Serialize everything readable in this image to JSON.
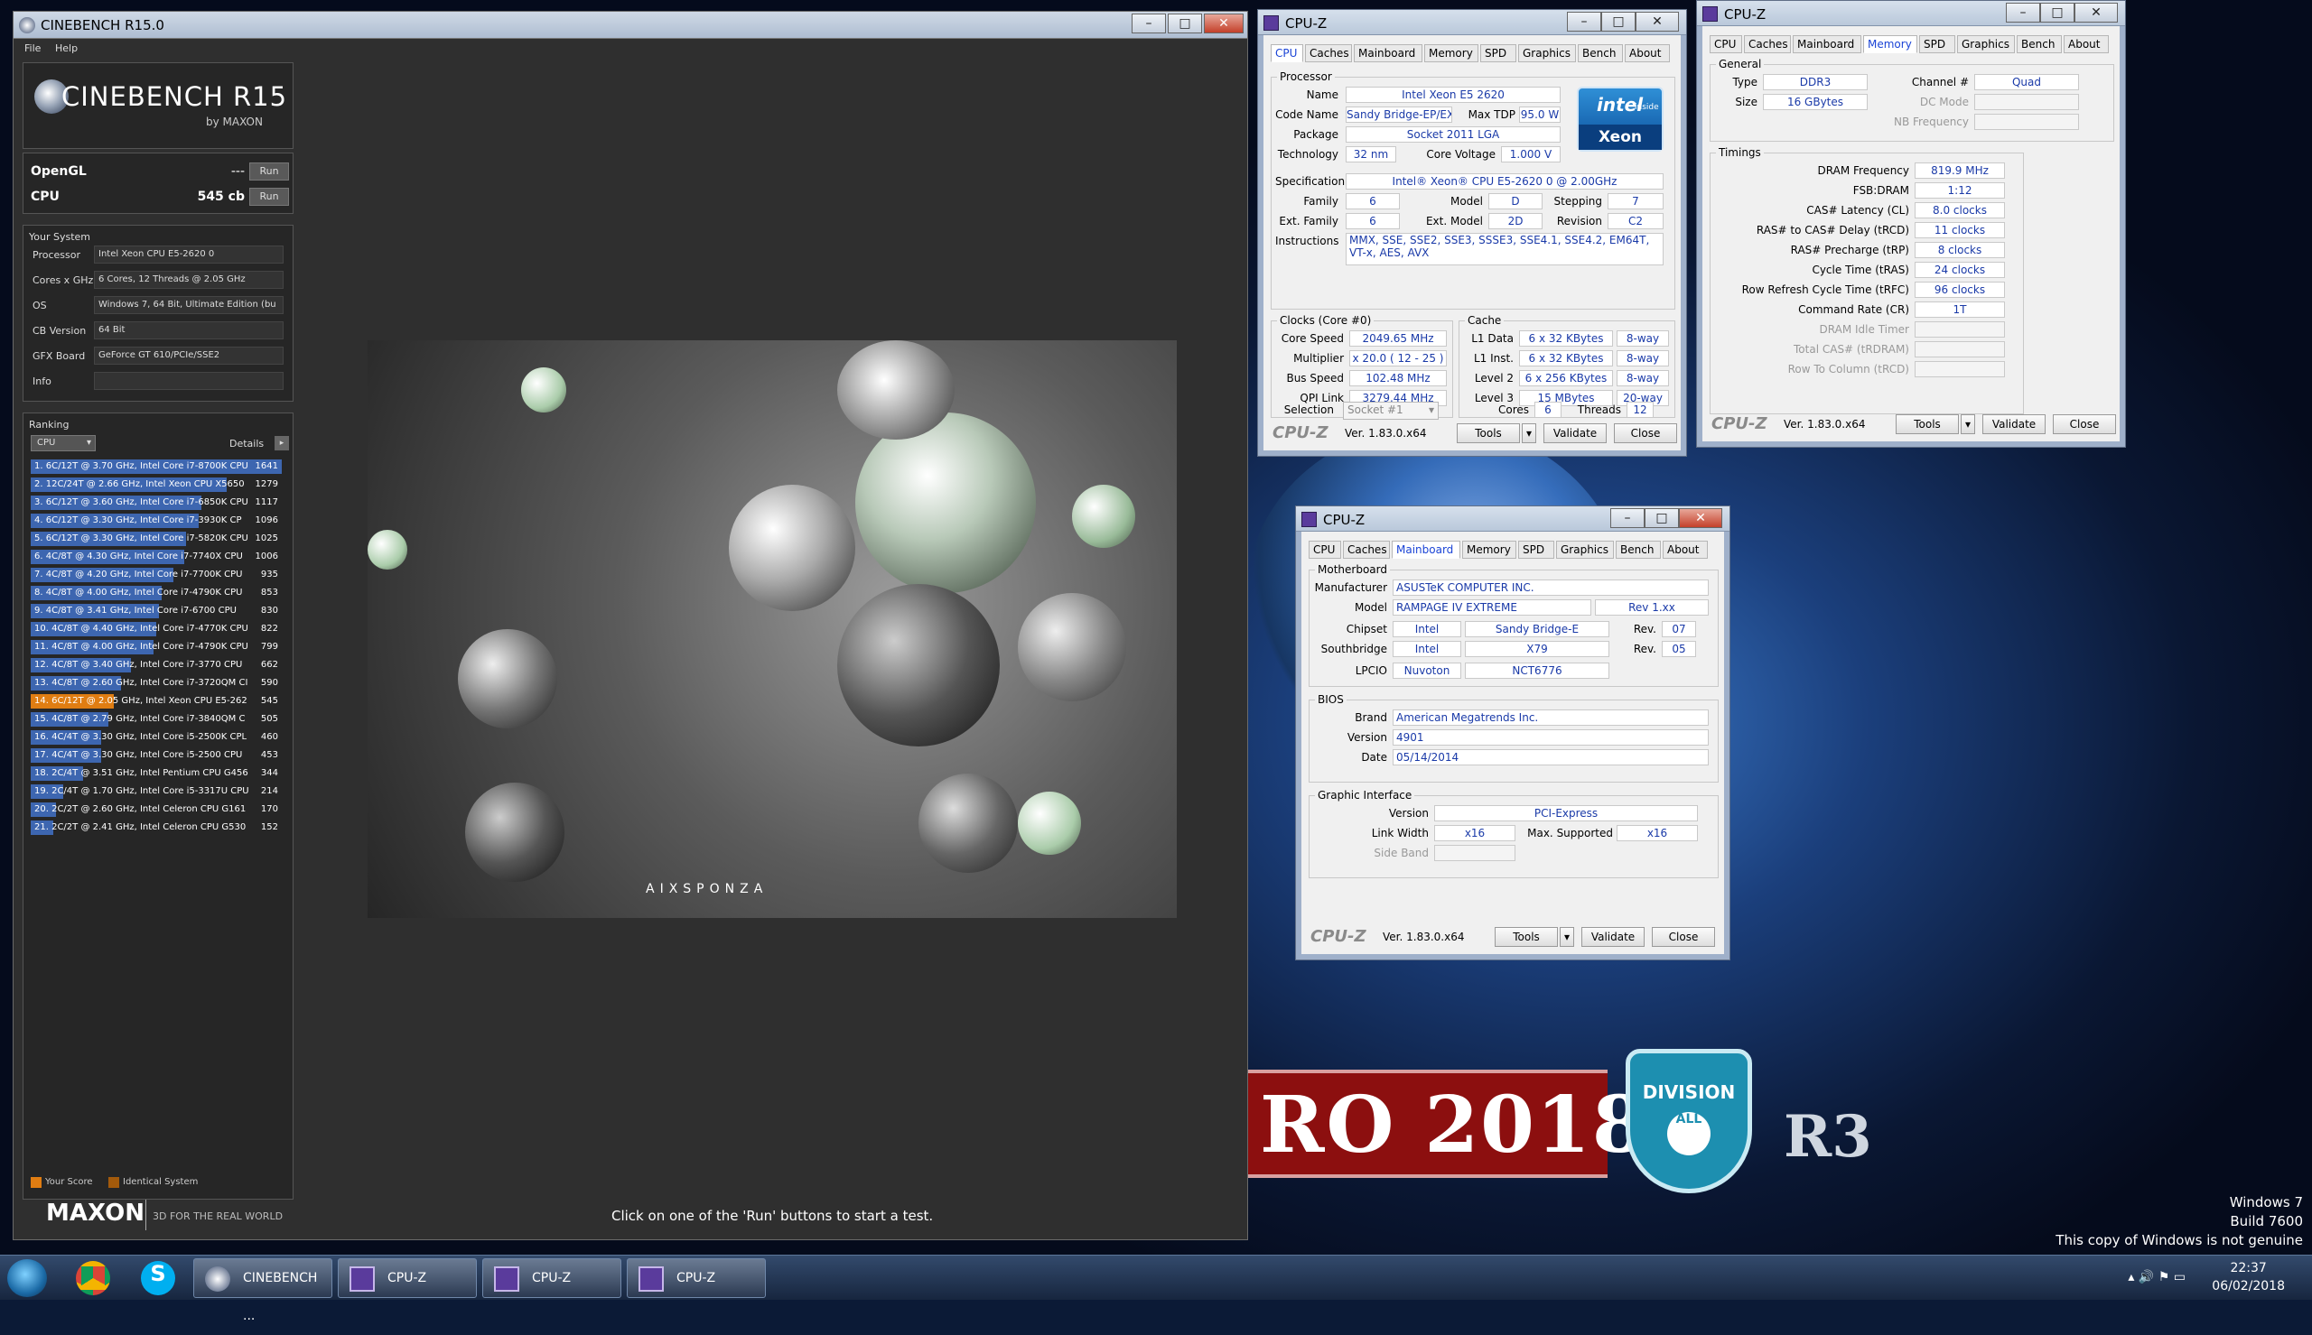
{
  "watermark": {
    "l1": "Windows 7",
    "l2": "Build 7600",
    "l3": "This copy of Windows is not genuine"
  },
  "banner": {
    "text": "RO 2018",
    "shield_top": "DIVISION",
    "shield_mid": "ALL",
    "right": "R3"
  },
  "cinebench": {
    "title": "CINEBENCH R15.0",
    "menu": {
      "file": "File",
      "help": "Help"
    },
    "logo": {
      "name": "CINEBENCH R15",
      "by": "by MAXON"
    },
    "opengl": {
      "label": "OpenGL",
      "value": "---",
      "run": "Run"
    },
    "cpu": {
      "label": "CPU",
      "value": "545 cb",
      "run": "Run"
    },
    "system": {
      "title": "Your System",
      "rows": [
        {
          "k": "Processor",
          "v": "Intel Xeon CPU E5-2620 0"
        },
        {
          "k": "Cores x GHz",
          "v": "6 Cores, 12 Threads @ 2.05 GHz"
        },
        {
          "k": "OS",
          "v": "Windows 7, 64 Bit, Ultimate Edition (bu"
        },
        {
          "k": "CB Version",
          "v": "64 Bit"
        },
        {
          "k": "GFX Board",
          "v": "GeForce GT 610/PCIe/SSE2"
        },
        {
          "k": "Info",
          "v": ""
        }
      ]
    },
    "ranking": {
      "title": "Ranking",
      "select": "CPU",
      "details": "Details",
      "items": [
        {
          "t": "1. 6C/12T @ 3.70 GHz, Intel Core i7-8700K CPU",
          "s": "1641",
          "f": 1.0
        },
        {
          "t": "2. 12C/24T @ 2.66 GHz, Intel Xeon CPU X5650",
          "s": "1279",
          "f": 0.78
        },
        {
          "t": "3. 6C/12T @ 3.60 GHz, Intel Core i7-6850K CPU",
          "s": "1117",
          "f": 0.68
        },
        {
          "t": "4. 6C/12T @ 3.30 GHz, Intel Core i7-3930K CP",
          "s": "1096",
          "f": 0.67
        },
        {
          "t": "5. 6C/12T @ 3.30 GHz, Intel Core i7-5820K CPU",
          "s": "1025",
          "f": 0.62
        },
        {
          "t": "6. 4C/8T @ 4.30 GHz, Intel Core i7-7740X CPU",
          "s": "1006",
          "f": 0.61
        },
        {
          "t": "7. 4C/8T @ 4.20 GHz, Intel Core i7-7700K CPU",
          "s": "935",
          "f": 0.57
        },
        {
          "t": "8. 4C/8T @ 4.00 GHz, Intel Core i7-4790K CPU",
          "s": "853",
          "f": 0.52
        },
        {
          "t": "9. 4C/8T @ 3.41 GHz, Intel Core i7-6700 CPU",
          "s": "830",
          "f": 0.51
        },
        {
          "t": "10. 4C/8T @ 4.40 GHz, Intel Core i7-4770K CPU",
          "s": "822",
          "f": 0.5
        },
        {
          "t": "11. 4C/8T @ 4.00 GHz, Intel Core i7-4790K CPU",
          "s": "799",
          "f": 0.49
        },
        {
          "t": "12. 4C/8T @ 3.40 GHz, Intel Core i7-3770 CPU",
          "s": "662",
          "f": 0.4
        },
        {
          "t": "13. 4C/8T @ 2.60 GHz, Intel Core i7-3720QM CI",
          "s": "590",
          "f": 0.36
        },
        {
          "t": "14. 6C/12T @ 2.05 GHz, Intel Xeon CPU E5-262",
          "s": "545",
          "f": 0.33,
          "mine": true
        },
        {
          "t": "15. 4C/8T @ 2.79 GHz, Intel Core i7-3840QM C",
          "s": "505",
          "f": 0.31
        },
        {
          "t": "16. 4C/4T @ 3.30 GHz, Intel Core i5-2500K CPL",
          "s": "460",
          "f": 0.28
        },
        {
          "t": "17. 4C/4T @ 3.30 GHz, Intel Core i5-2500 CPU",
          "s": "453",
          "f": 0.28
        },
        {
          "t": "18. 2C/4T @ 3.51 GHz, Intel Pentium CPU G456",
          "s": "344",
          "f": 0.21
        },
        {
          "t": "19. 2C/4T @ 1.70 GHz, Intel Core i5-3317U CPU",
          "s": "214",
          "f": 0.13
        },
        {
          "t": "20. 2C/2T @ 2.60 GHz, Intel Celeron CPU G161",
          "s": "170",
          "f": 0.1
        },
        {
          "t": "21. 2C/2T @ 2.41 GHz, Intel Celeron CPU G530",
          "s": "152",
          "f": 0.09
        }
      ],
      "legend_yours": "Your Score",
      "legend_identical": "Identical System"
    },
    "render_brand": "AIXSPONZA",
    "maxon": "MAXON",
    "maxon_sub": "3D FOR THE REAL WORLD",
    "status": "Click on one of the 'Run' buttons to start a test."
  },
  "cpuz_tabs": [
    "CPU",
    "Caches",
    "Mainboard",
    "Memory",
    "SPD",
    "Graphics",
    "Bench",
    "About"
  ],
  "cpuz_common": {
    "title": "CPU-Z",
    "logo": "CPU-Z",
    "version": "Ver. 1.83.0.x64",
    "tools": "Tools",
    "validate": "Validate",
    "close": "Close"
  },
  "cpuz_cpu": {
    "processor_group": "Processor",
    "name": "Intel Xeon E5 2620",
    "codename": "Sandy Bridge-EP/EX",
    "maxtdp": "95.0 W",
    "package": "Socket 2011 LGA",
    "technology": "32 nm",
    "corevoltage": "1.000 V",
    "spec": "Intel® Xeon® CPU E5-2620 0 @ 2.00GHz",
    "family": "6",
    "model": "D",
    "stepping": "7",
    "extfamily": "6",
    "extmodel": "2D",
    "revision": "C2",
    "instructions1": "MMX, SSE, SSE2, SSE3, SSSE3, SSE4.1, SSE4.2, EM64T,",
    "instructions2": "VT-x, AES, AVX",
    "labels": {
      "name": "Name",
      "codename": "Code Name",
      "maxtdp": "Max TDP",
      "package": "Package",
      "technology": "Technology",
      "corevoltage": "Core Voltage",
      "spec": "Specification",
      "family": "Family",
      "model": "Model",
      "stepping": "Stepping",
      "extfamily": "Ext. Family",
      "extmodel": "Ext. Model",
      "revision": "Revision",
      "instructions": "Instructions"
    },
    "intel_badge": "intel",
    "intel_inside": "inside",
    "xeon_badge": "Xeon",
    "clocks_group": "Clocks (Core #0)",
    "corespeed": "2049.65 MHz",
    "multiplier": "x 20.0 ( 12 - 25 )",
    "busspeed": "102.48 MHz",
    "qpilink": "3279.44 MHz",
    "clock_labels": {
      "corespeed": "Core Speed",
      "multiplier": "Multiplier",
      "busspeed": "Bus Speed",
      "qpilink": "QPI Link"
    },
    "cache_group": "Cache",
    "l1d": "6 x 32 KBytes",
    "l1d_w": "8-way",
    "l1i": "6 x 32 KBytes",
    "l1i_w": "8-way",
    "l2": "6 x 256 KBytes",
    "l2_w": "8-way",
    "l3": "15 MBytes",
    "l3_w": "20-way",
    "cache_labels": {
      "l1d": "L1 Data",
      "l1i": "L1 Inst.",
      "l2": "Level 2",
      "l3": "Level 3"
    },
    "selection_label": "Selection",
    "selection": "Socket #1",
    "cores_label": "Cores",
    "cores": "6",
    "threads_label": "Threads",
    "threads": "12"
  },
  "cpuz_mem": {
    "general_group": "General",
    "type_label": "Type",
    "type": "DDR3",
    "size_label": "Size",
    "size": "16 GBytes",
    "channel_label": "Channel #",
    "channel": "Quad",
    "dcmode_label": "DC Mode",
    "nbfreq_label": "NB Frequency",
    "timings_group": "Timings",
    "rows": [
      {
        "k": "DRAM Frequency",
        "v": "819.9 MHz"
      },
      {
        "k": "FSB:DRAM",
        "v": "1:12"
      },
      {
        "k": "CAS# Latency (CL)",
        "v": "8.0 clocks"
      },
      {
        "k": "RAS# to CAS# Delay (tRCD)",
        "v": "11 clocks"
      },
      {
        "k": "RAS# Precharge (tRP)",
        "v": "8 clocks"
      },
      {
        "k": "Cycle Time (tRAS)",
        "v": "24 clocks"
      },
      {
        "k": "Row Refresh Cycle Time (tRFC)",
        "v": "96 clocks"
      },
      {
        "k": "Command Rate (CR)",
        "v": "1T"
      }
    ],
    "dim_rows": [
      {
        "k": "DRAM Idle Timer"
      },
      {
        "k": "Total CAS# (tRDRAM)"
      },
      {
        "k": "Row To Column (tRCD)"
      }
    ]
  },
  "cpuz_mb": {
    "mb_group": "Motherboard",
    "manufacturer_label": "Manufacturer",
    "manufacturer": "ASUSTeK COMPUTER INC.",
    "model_label": "Model",
    "model": "RAMPAGE IV EXTREME",
    "model_rev": "Rev 1.xx",
    "chipset_label": "Chipset",
    "chipset_v": "Intel",
    "chipset_n": "Sandy Bridge-E",
    "rev_label": "Rev.",
    "chipset_rev": "07",
    "south_label": "Southbridge",
    "south_v": "Intel",
    "south_n": "X79",
    "south_rev": "05",
    "lpcio_label": "LPCIO",
    "lpcio_v": "Nuvoton",
    "lpcio_n": "NCT6776",
    "bios_group": "BIOS",
    "brand_label": "Brand",
    "brand": "American Megatrends Inc.",
    "version_label": "Version",
    "version": "4901",
    "date_label": "Date",
    "date": "05/14/2014",
    "gi_group": "Graphic Interface",
    "gi_version": "PCI-Express",
    "linkwidth_label": "Link Width",
    "linkwidth": "x16",
    "maxsup_label": "Max. Supported",
    "maxsup": "x16",
    "sideband_label": "Side Band"
  },
  "taskbar": {
    "tasks": [
      "CINEBENCH ...",
      "CPU-Z",
      "CPU-Z",
      "CPU-Z"
    ],
    "time": "22:37",
    "date": "06/02/2018"
  }
}
